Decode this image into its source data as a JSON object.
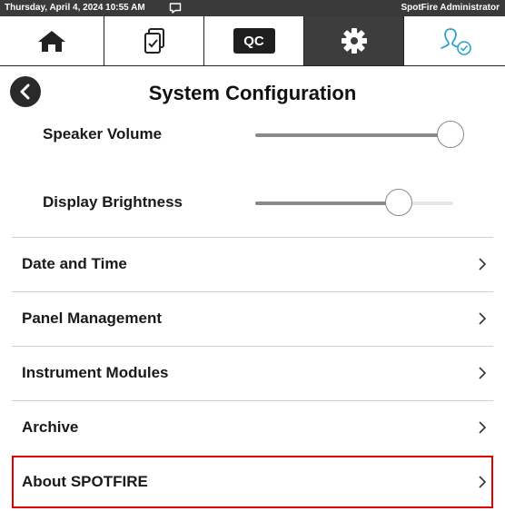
{
  "status_bar": {
    "datetime": "Thursday, April 4, 2024 10:55 AM",
    "user": "SpotFire Administrator",
    "message_icon": "message-icon"
  },
  "nav": {
    "tabs": [
      {
        "name": "home",
        "icon": "home-icon"
      },
      {
        "name": "tasks",
        "icon": "checklist-icon"
      },
      {
        "name": "qc",
        "label": "QC"
      },
      {
        "name": "settings",
        "icon": "gear-icon",
        "active": true
      },
      {
        "name": "user",
        "icon": "user-check-icon"
      }
    ]
  },
  "page": {
    "title": "System Configuration",
    "back_icon": "back-arrow-icon"
  },
  "sliders": [
    {
      "label": "Speaker Volume",
      "value": 0.99
    },
    {
      "label": "Display Brightness",
      "value": 0.73
    }
  ],
  "menu": [
    {
      "label": "Date and Time"
    },
    {
      "label": "Panel Management"
    },
    {
      "label": "Instrument Modules"
    },
    {
      "label": "Archive"
    },
    {
      "label": "About SPOTFIRE",
      "highlighted": true
    }
  ],
  "colors": {
    "status_bar": "#3a3a3a",
    "active_tab": "#3d3d3d",
    "highlight_border": "#e00000",
    "user_icon": "#2aa5c8"
  }
}
